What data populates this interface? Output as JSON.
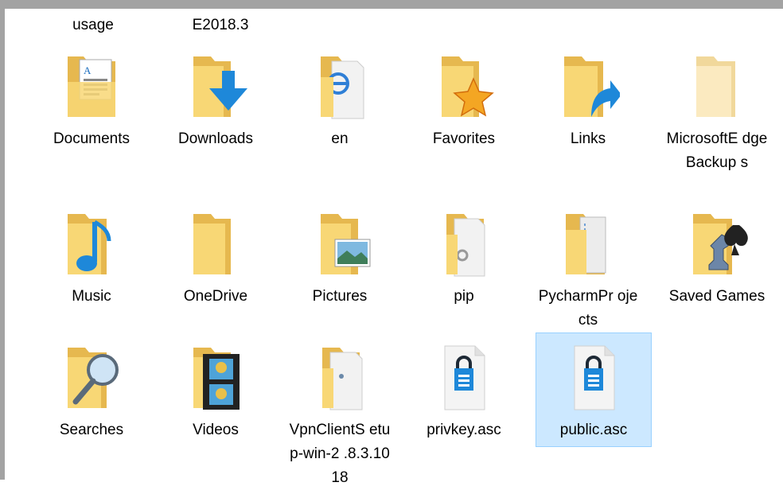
{
  "top_row_labels": [
    "usage",
    "E2018.3"
  ],
  "items": [
    {
      "label": "Documents",
      "icon": "folder-documents-icon"
    },
    {
      "label": "Downloads",
      "icon": "folder-downloads-icon"
    },
    {
      "label": "en",
      "icon": "folder-ie-page-icon"
    },
    {
      "label": "Favorites",
      "icon": "folder-favorites-icon"
    },
    {
      "label": "Links",
      "icon": "folder-links-icon"
    },
    {
      "label": "MicrosoftE dgeBackup s",
      "icon": "folder-pale-icon"
    },
    {
      "label": "Music",
      "icon": "folder-music-icon"
    },
    {
      "label": "OneDrive",
      "icon": "folder-icon"
    },
    {
      "label": "Pictures",
      "icon": "folder-pictures-icon"
    },
    {
      "label": "pip",
      "icon": "folder-gear-page-icon"
    },
    {
      "label": "PycharmPr ojects",
      "icon": "folder-pages-icon"
    },
    {
      "label": "Saved Games",
      "icon": "folder-saved-games-icon"
    },
    {
      "label": "Searches",
      "icon": "folder-searches-icon"
    },
    {
      "label": "Videos",
      "icon": "folder-videos-icon"
    },
    {
      "label": "VpnClientS etup-win-2 .8.3.1018",
      "icon": "folder-page-icon"
    },
    {
      "label": "privkey.asc",
      "icon": "lock-file-icon"
    },
    {
      "label": "public.asc",
      "icon": "lock-file-icon",
      "selected": true
    }
  ],
  "colors": {
    "folder_back": "#e6b84f",
    "folder_front": "#f8d775",
    "accent_blue": "#1e88d9",
    "selection_bg": "#cce8ff",
    "selection_border": "#99d1ff"
  }
}
